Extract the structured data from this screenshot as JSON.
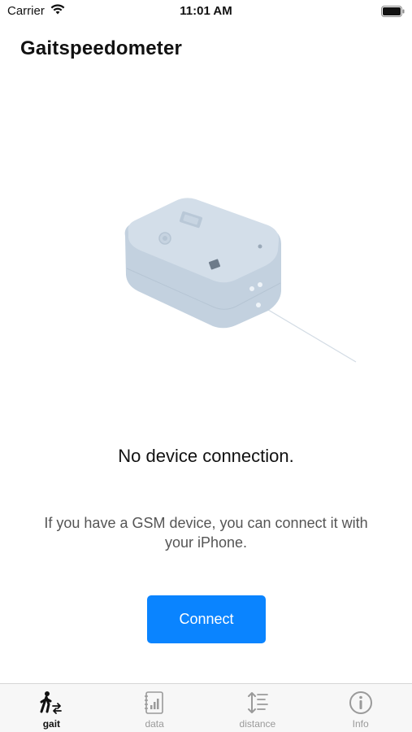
{
  "status_bar": {
    "carrier": "Carrier",
    "time": "11:01 AM",
    "wifi_icon": "wifi-icon",
    "battery_icon": "battery-icon",
    "battery_level": 1.0
  },
  "header": {
    "title": "Gaitspeedometer"
  },
  "main": {
    "illustration_icon": "gsm-device-illustration",
    "headline": "No device connection.",
    "description": "If you have a GSM device, you can connect it with your iPhone.",
    "connect_label": "Connect"
  },
  "tab_bar": {
    "tabs": [
      {
        "label": "gait",
        "icon": "walking-person-icon",
        "active": true
      },
      {
        "label": "data",
        "icon": "data-notebook-icon",
        "active": false
      },
      {
        "label": "distance",
        "icon": "distance-icon",
        "active": false
      },
      {
        "label": "Info",
        "icon": "info-icon",
        "active": false
      }
    ]
  },
  "colors": {
    "accent": "#0a84ff",
    "tab_active": "#111111",
    "tab_inactive": "#9a9a9a",
    "device": "#c9d6e3"
  }
}
